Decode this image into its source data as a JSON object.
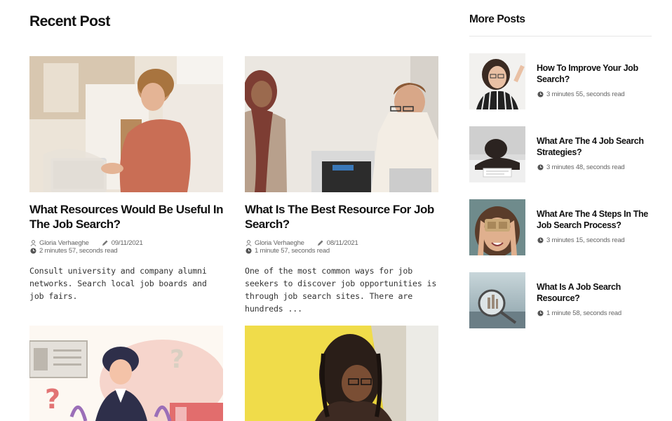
{
  "recent": {
    "title": "Recent Post",
    "posts": [
      {
        "title": "What Resources Would Be Useful In The Job Search?",
        "author": "Gloria Verhaeghe",
        "date": "09/11/2021",
        "read_time": "2 minutes 57, seconds read",
        "excerpt": "Consult university and company alumni networks. Search local job boards and job fairs."
      },
      {
        "title": "What Is The Best Resource For Job Search?",
        "author": "Gloria Verhaeghe",
        "date": "08/11/2021",
        "read_time": "1 minute 57, seconds read",
        "excerpt": "One of the most common ways for job seekers to discover job opportunities is through job search sites. There are hundreds ..."
      }
    ]
  },
  "more": {
    "title": "More Posts",
    "items": [
      {
        "title": "How To Improve Your Job Search?",
        "read_time": "3 minutes 55, seconds read"
      },
      {
        "title": "What Are The 4 Job Search Strategies?",
        "read_time": "3 minutes 48, seconds read"
      },
      {
        "title": "What Are The 4 Steps In The Job Search Process?",
        "read_time": "3 minutes 15, seconds read"
      },
      {
        "title": "What Is A Job Search Resource?",
        "read_time": "1 minute 58, seconds read"
      }
    ]
  },
  "icons": {
    "author": "user-icon",
    "date": "pencil-icon",
    "read_time": "clock-icon"
  }
}
